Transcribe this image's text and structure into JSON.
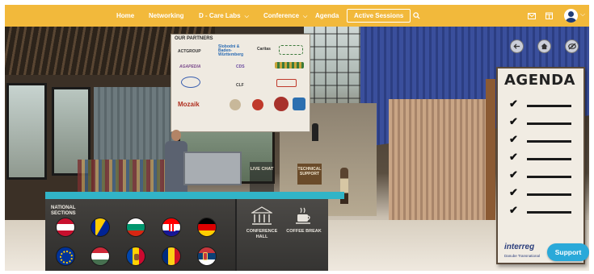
{
  "nav": {
    "home": "Home",
    "networking": "Networking",
    "labs": "D - Care Labs",
    "conference": "Conference",
    "agenda": "Agenda",
    "active_sessions": "Active Sessions",
    "search_icon": "search-icon",
    "mail_icon": "mail-icon",
    "calendar_icon": "calendar-icon",
    "avatar_icon": "user-avatar-icon"
  },
  "scene": {
    "partners_title": "OUR PARTNERS",
    "partner_logos": [
      "ACTGROUP",
      "Slobodni & Baden-Württemberg",
      "Caritas",
      "AGAPEDIA",
      "CDS",
      "CLF",
      "Mozaik"
    ],
    "agenda_title": "AGENDA",
    "agenda_logo": "interreg",
    "agenda_logo_sub": "Danube Transnational",
    "live_chat": "LIVE CHAT",
    "technical_support": "TECHNICAL SUPPORT",
    "national_sections": "NATIONAL SECTIONS",
    "conference_hall": "CONFERENCE HALL",
    "coffee_break": "COFFEE BREAK"
  },
  "controls": {
    "back_icon": "arrow-left-icon",
    "home_icon": "home-icon",
    "hide_icon": "eye-slash-icon"
  },
  "support": "Support",
  "colors": {
    "topbar": "#f2b93b",
    "counter_accent": "#31b4c7",
    "support": "#2aa9d9"
  }
}
